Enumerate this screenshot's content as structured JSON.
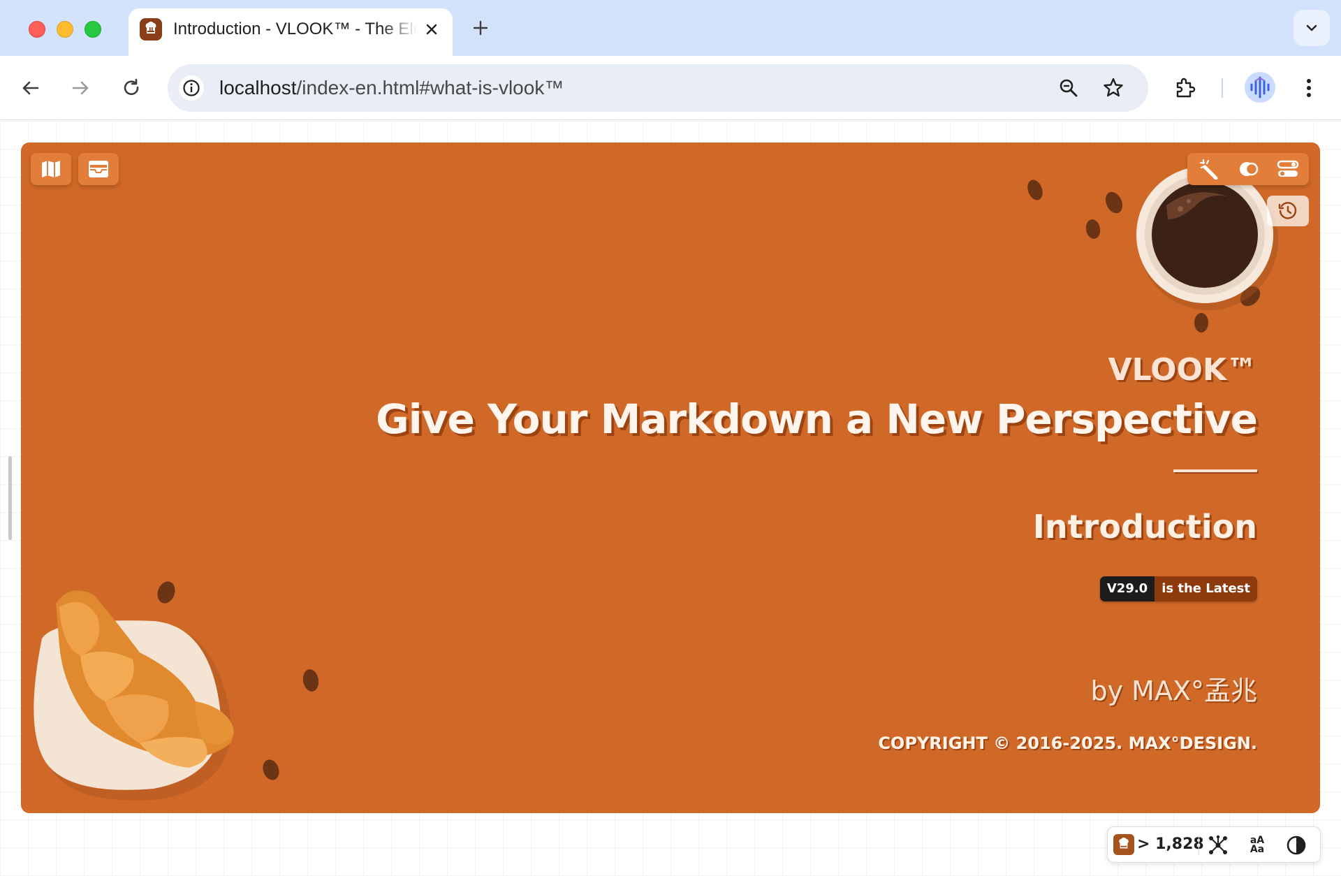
{
  "browser": {
    "tab": {
      "title": "Introduction - VLOOK™ - The Elegant & Practical Theme for Typora",
      "favicon": "vlook-chef-hat-icon"
    },
    "address": {
      "host": "localhost",
      "path": "/index-en.html#what-is-vlook™"
    },
    "icons": {
      "back": "back-arrow-icon",
      "forward": "forward-arrow-icon",
      "reload": "reload-icon",
      "site_info": "info-icon",
      "zoom": "zoom-icon",
      "bookmark": "star-icon",
      "extensions": "puzzle-icon",
      "profile": "avatar",
      "menu": "kebab-menu-icon"
    }
  },
  "cover": {
    "brand": "VLOOK™",
    "headline": "Give Your Markdown a New Perspective",
    "subtitle": "Introduction",
    "badge": {
      "version": "V29.0",
      "status": "is the Latest"
    },
    "author": "by MAX°孟兆",
    "copyright": "COPYRIGHT © 2016-2025. MAX°DESIGN.",
    "colors": {
      "background": "#d06828",
      "shadow": "#9b4411",
      "button": "#e27d3a"
    }
  },
  "bottom_bar": {
    "count": "> 1,828"
  }
}
